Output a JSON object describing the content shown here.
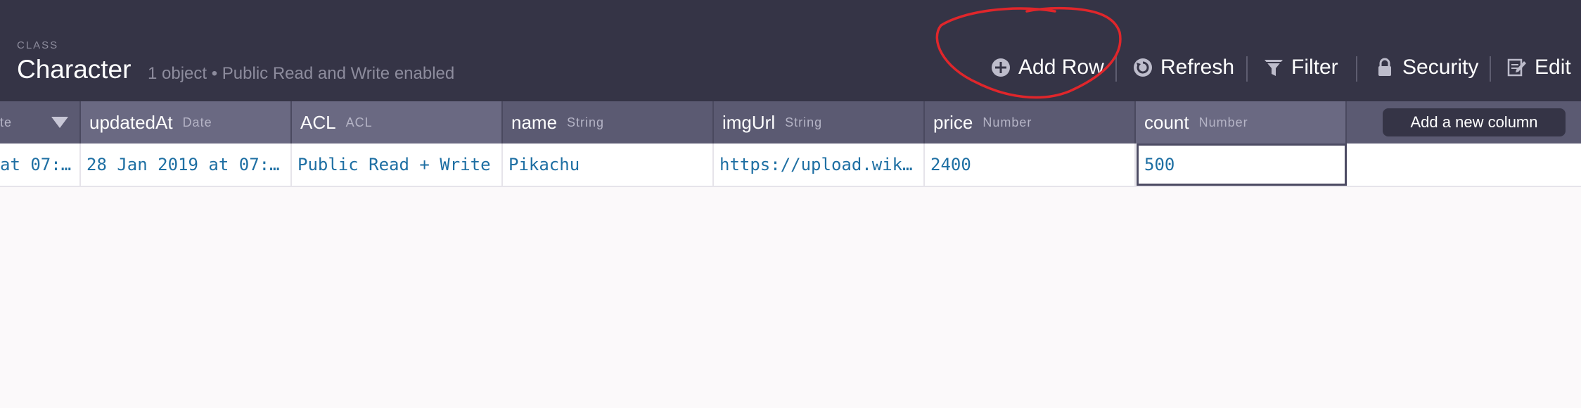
{
  "header": {
    "class_label": "CLASS",
    "class_name": "Character",
    "subtitle": "1 object • Public Read and Write enabled"
  },
  "toolbar": {
    "add_row": "Add Row",
    "refresh": "Refresh",
    "filter": "Filter",
    "security": "Security",
    "edit": "Edit"
  },
  "columns": [
    {
      "name": "",
      "type": "te"
    },
    {
      "name": "updatedAt",
      "type": "Date"
    },
    {
      "name": "ACL",
      "type": "ACL"
    },
    {
      "name": "name",
      "type": "String"
    },
    {
      "name": "imgUrl",
      "type": "String"
    },
    {
      "name": "price",
      "type": "Number"
    },
    {
      "name": "count",
      "type": "Number"
    }
  ],
  "add_column_label": "Add a new column",
  "row": {
    "cells": [
      "at 07:…",
      "28 Jan 2019 at 07:…",
      "Public Read + Write",
      "Pikachu",
      "https://upload.wik…",
      "2400",
      "500"
    ]
  },
  "colors": {
    "header_bg": "#353446",
    "table_header_bg": "#6a6982",
    "cell_text": "#1e6fa3",
    "annotation": "#e0262b"
  },
  "icons": {
    "add_row": "plus-circle-icon",
    "refresh": "refresh-icon",
    "filter": "funnel-icon",
    "security": "lock-icon",
    "edit": "edit-icon",
    "sort": "sort-down-icon"
  }
}
